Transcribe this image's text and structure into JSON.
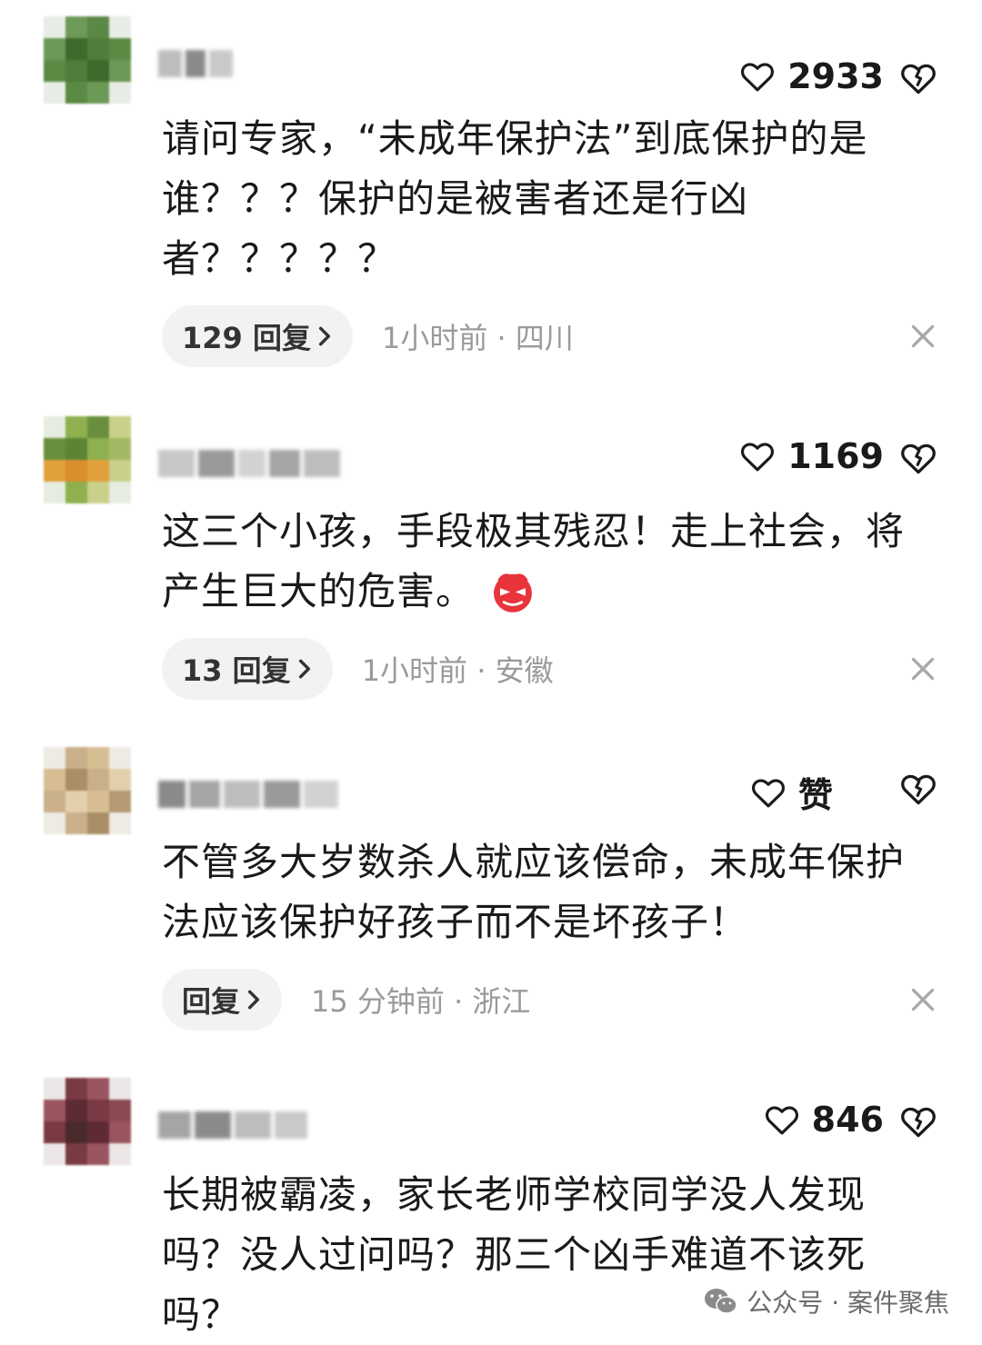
{
  "comments": [
    {
      "avatar_colors": [
        "#4f7d3a",
        "#3e6a2c",
        "#5a8a44",
        "#6c9955"
      ],
      "likes": "2933",
      "lines": [
        "请问专家，“未成年保护法”到底保护的是",
        "谁？？？保护的是被害者还是行凶",
        "者？？？？？"
      ],
      "reply_label": "129 回复",
      "meta": "1小时前 · 四川"
    },
    {
      "avatar_colors": [
        "#8fb04f",
        "#e0a03c",
        "#6a8f3c",
        "#c9d08a"
      ],
      "likes": "1169",
      "lines": [
        "这三个小孩，手段极其残忍！走上社会，将",
        "产生巨大的危害。"
      ],
      "has_angry_emoji": true,
      "reply_label": "13 回复",
      "meta": "1小时前 · 安徽"
    },
    {
      "avatar_colors": [
        "#c9b08a",
        "#d7bd92",
        "#a98e66",
        "#e3cfaa"
      ],
      "likes": "赞",
      "lines": [
        "不管多大岁数杀人就应该偿命，未成年保护",
        "法应该保护好孩子而不是坏孩子！"
      ],
      "reply_label": "回复",
      "meta": "15 分钟前 · 浙江"
    },
    {
      "avatar_colors": [
        "#7a3a44",
        "#5e2a33",
        "#9a5560",
        "#4a2a2a"
      ],
      "likes": "846",
      "lines": [
        "长期被霸凌，家长老师学校同学没人发现",
        "吗？没人过问吗？那三个凶手难道不该死",
        "吗？"
      ],
      "reply_label": null,
      "meta": null
    }
  ],
  "watermark": {
    "text": "公众号 · 案件聚焦"
  }
}
